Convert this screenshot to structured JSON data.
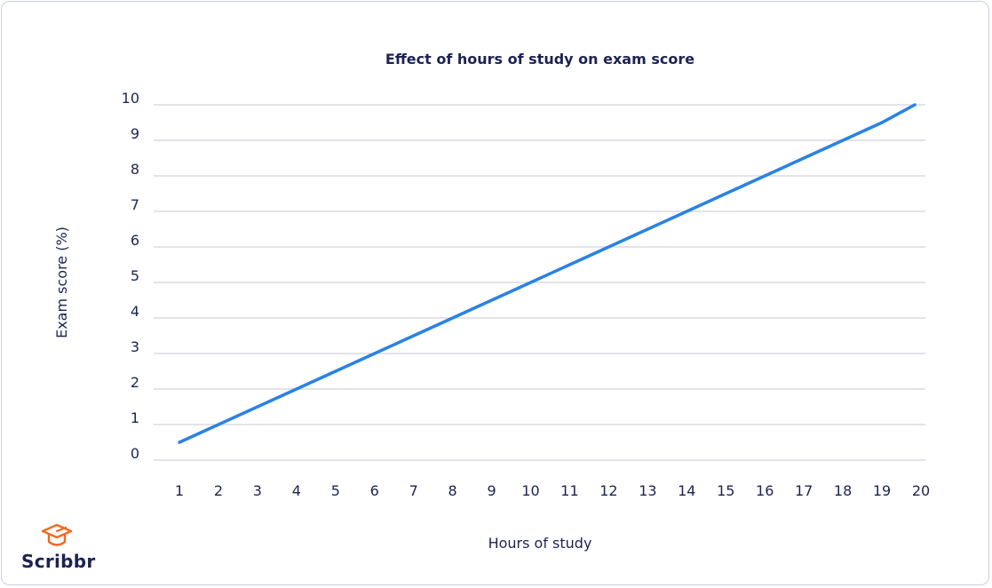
{
  "brand": {
    "name": "Scribbr",
    "icon": "graduation-cap-icon",
    "accent_color": "#f26a21",
    "text_color": "#1c2352"
  },
  "chart_data": {
    "type": "line",
    "title": "Effect of hours of study on exam score",
    "xlabel": "Hours of study",
    "ylabel": "Exam score (%)",
    "x": [
      1,
      2,
      3,
      4,
      5,
      6,
      7,
      8,
      9,
      10,
      11,
      12,
      13,
      14,
      15,
      16,
      17,
      18,
      19,
      20
    ],
    "series": [
      {
        "name": "Exam score",
        "color": "#2a82e4",
        "values": [
          0.5,
          1,
          1.5,
          2,
          2.5,
          3,
          3.5,
          4,
          4.5,
          5,
          5.5,
          6,
          6.5,
          7,
          7.5,
          8,
          8.5,
          9,
          9.5,
          10
        ]
      }
    ],
    "xticks": [
      "1",
      "2",
      "3",
      "4",
      "5",
      "6",
      "7",
      "8",
      "9",
      "10",
      "11",
      "12",
      "13",
      "14",
      "15",
      "16",
      "17",
      "18",
      "19",
      "20"
    ],
    "yticks": [
      "0",
      "1",
      "2",
      "3",
      "4",
      "5",
      "6",
      "7",
      "8",
      "9",
      "10"
    ],
    "ylim": [
      0,
      10
    ],
    "xlim": [
      1,
      20
    ],
    "grid": "horizontal",
    "legend": "none"
  }
}
